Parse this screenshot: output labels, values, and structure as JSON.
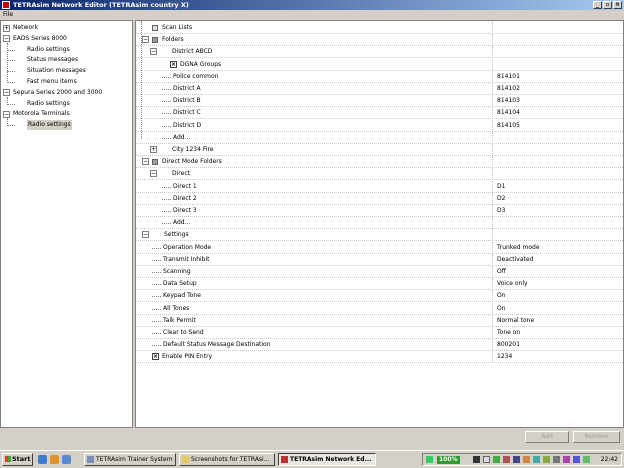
{
  "window": {
    "title": "TETRAsim Network Editor (TETRAsim country X)"
  },
  "menu": {
    "file": "File"
  },
  "left_tree": [
    {
      "label": "Network",
      "level": 0,
      "toggle": "+"
    },
    {
      "label": "EADS Series 8000",
      "level": 0,
      "toggle": "−"
    },
    {
      "label": "Radio settings",
      "level": 1
    },
    {
      "label": "Status messages",
      "level": 1
    },
    {
      "label": "Situation messages",
      "level": 1
    },
    {
      "label": "Fast menu items",
      "level": 1
    },
    {
      "label": "Sepura Series 2000 and 3000",
      "level": 0,
      "toggle": "−"
    },
    {
      "label": "Radio settings",
      "level": 1
    },
    {
      "label": "Motorola Terminals",
      "level": 0,
      "toggle": "−"
    },
    {
      "label": "Radio settings",
      "level": 1,
      "selected": true
    }
  ],
  "right_tree": [
    {
      "label": "Scan Lists",
      "value": "",
      "level": 1,
      "icon": "doc"
    },
    {
      "label": "Folders",
      "value": "",
      "level": 1,
      "toggle": "−",
      "icon": "folder"
    },
    {
      "label": "District ABCD",
      "value": "",
      "level": 2,
      "toggle": "−"
    },
    {
      "label": "DGNA Groups",
      "value": "",
      "level": 3,
      "check": true
    },
    {
      "label": "Police common",
      "value": "814101",
      "level": 3
    },
    {
      "label": "District A",
      "value": "814102",
      "level": 3
    },
    {
      "label": "District B",
      "value": "814103",
      "level": 3
    },
    {
      "label": "District C",
      "value": "814104",
      "level": 3
    },
    {
      "label": "District D",
      "value": "814105",
      "level": 3
    },
    {
      "label": "Add...",
      "value": "",
      "level": 3
    },
    {
      "label": "City 1234 Fire",
      "value": "",
      "level": 2,
      "toggle": "+"
    },
    {
      "label": "Direct Mode Folders",
      "value": "",
      "level": 1,
      "toggle": "−",
      "icon": "folder"
    },
    {
      "label": "Direct",
      "value": "",
      "level": 2,
      "toggle": "−"
    },
    {
      "label": "Direct 1",
      "value": "D1",
      "level": 3
    },
    {
      "label": "Direct 2",
      "value": "D2",
      "level": 3
    },
    {
      "label": "Direct 3",
      "value": "D3",
      "level": 3
    },
    {
      "label": "Add...",
      "value": "",
      "level": 3
    },
    {
      "label": "Settings",
      "value": "",
      "level": 1,
      "toggle": "−"
    },
    {
      "label": "Operation Mode",
      "value": "Trunked mode",
      "level": 2
    },
    {
      "label": "Transmit Inhibit",
      "value": "Deactivated",
      "level": 2
    },
    {
      "label": "Scanning",
      "value": "Off",
      "level": 2
    },
    {
      "label": "Data Setup",
      "value": "Voice only",
      "level": 2
    },
    {
      "label": "Keypad Tone",
      "value": "On",
      "level": 2
    },
    {
      "label": "All Tones",
      "value": "On",
      "level": 2
    },
    {
      "label": "Talk Permit",
      "value": "Normal tone",
      "level": 2
    },
    {
      "label": "Clear to Send",
      "value": "Tone on",
      "level": 2
    },
    {
      "label": "Default Status Message Destination",
      "value": "800201",
      "level": 2
    },
    {
      "label": "Enable PIN Entry",
      "value": "1234",
      "level": 1,
      "check": true
    }
  ],
  "buttons": {
    "add": "Add",
    "remove": "Remove"
  },
  "taskbar": {
    "start": "Start",
    "tasks": [
      {
        "label": "TETRAsim Trainer System",
        "active": false
      },
      {
        "label": "Screenshots for TETRAsi...",
        "active": false
      },
      {
        "label": "TETRAsim Network Ed...",
        "active": true
      }
    ],
    "battery": "100%",
    "clock": "22:42"
  },
  "colors": {
    "title_start": "#0a246a",
    "title_end": "#a6caf0",
    "selection": "#d4d0c8"
  }
}
